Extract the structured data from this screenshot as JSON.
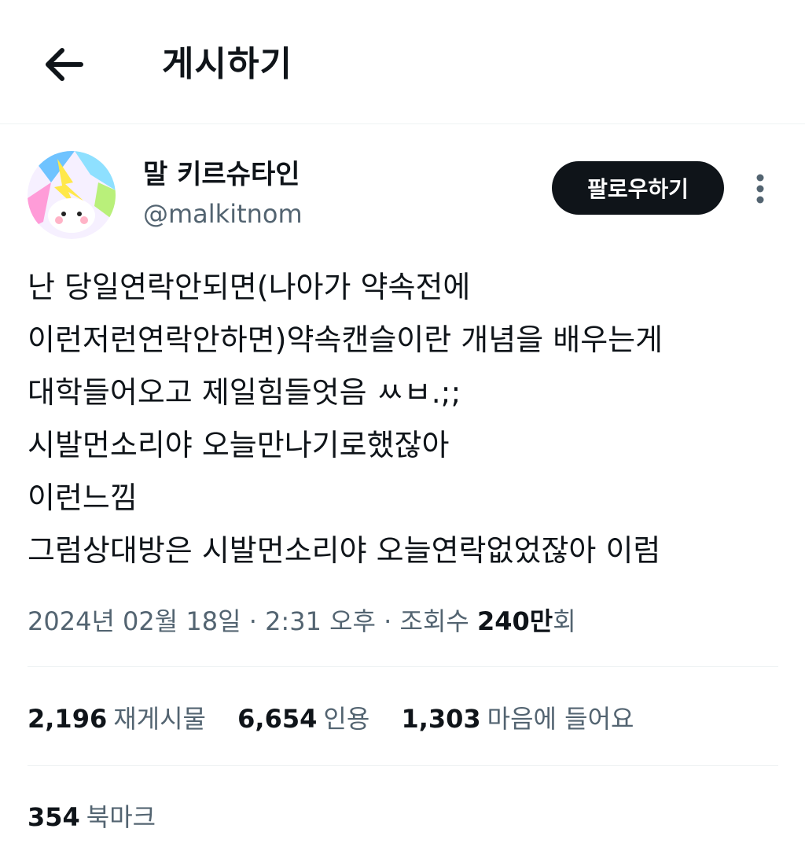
{
  "header": {
    "title": "게시하기"
  },
  "author": {
    "display_name": "말 키르슈타인",
    "handle": "@malkitnom",
    "follow_label": "팔로우하기"
  },
  "tweet": {
    "lines": [
      "난 당일연락안되면(나아가 약속전에",
      "이런저런연락안하면)약속캔슬이란 개념을 배우는게",
      "대학들어오고 제일힘들엇음 ㅆㅂ.;;",
      "시발먼소리야 오늘만나기로했잖아",
      "이런느낌",
      "그럼상대방은 시발먼소리야 오늘연락없었잖아 이럼"
    ],
    "meta": {
      "date": "2024년 02월 18일",
      "sep1": " · ",
      "time": "2:31 오후",
      "sep2": " · ",
      "views_label": "조회수 ",
      "views_value": "240만",
      "views_suffix": "회"
    }
  },
  "stats": {
    "retweets": {
      "count": "2,196",
      "label": "재게시물"
    },
    "quotes": {
      "count": "6,654",
      "label": "인용"
    },
    "likes": {
      "count": "1,303",
      "label": "마음에 들어요"
    },
    "bookmarks": {
      "count": "354",
      "label": "북마크"
    }
  },
  "colors": {
    "text": "#0f1419",
    "secondary": "#536471",
    "divider": "#eff3f4",
    "follow_bg": "#0f1419"
  },
  "icons": {
    "back": "arrow-left-icon",
    "more": "vertical-dots-icon"
  }
}
